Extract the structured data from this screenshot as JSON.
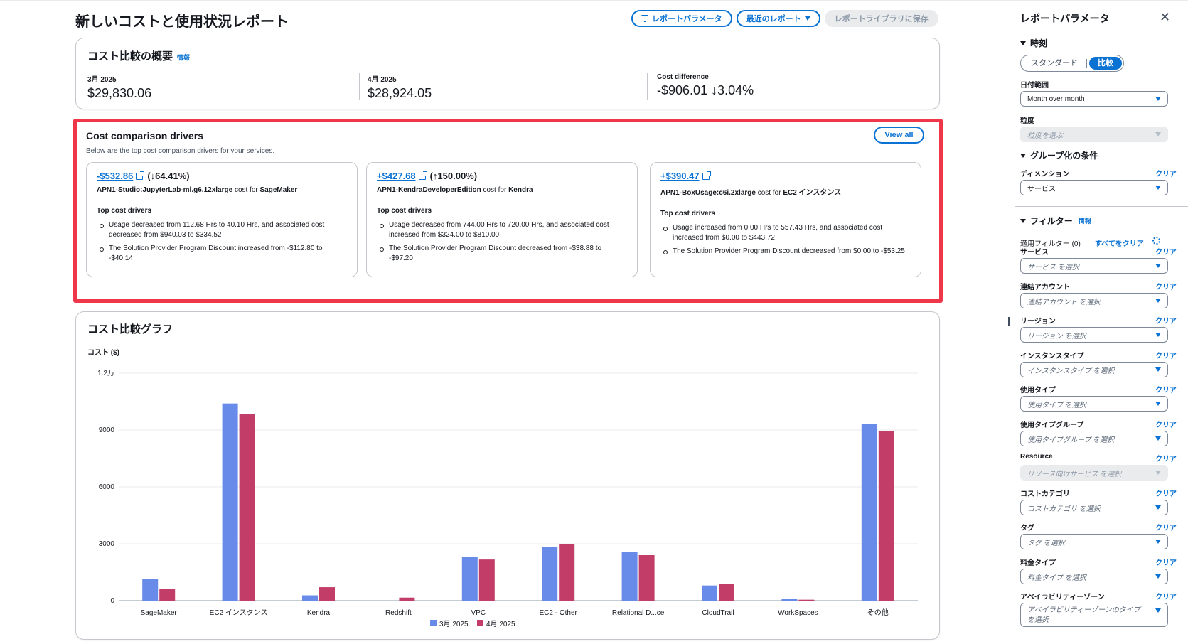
{
  "header": {
    "title": "新しいコストと使用状況レポート",
    "btn_params": "レポートパラメータ",
    "btn_recent": "最近のレポート",
    "btn_save": "レポートライブラリに保存"
  },
  "summary": {
    "title": "コスト比較の概要",
    "info": "情報",
    "items": [
      {
        "label": "3月 2025",
        "value": "$29,830.06"
      },
      {
        "label": "4月 2025",
        "value": "$28,924.05"
      },
      {
        "label": "Cost difference",
        "value": "-$906.01 ↓3.04%"
      }
    ]
  },
  "drivers": {
    "title": "Cost comparison drivers",
    "subtitle": "Below are the top cost comparison drivers for your services.",
    "view_all": "View all",
    "top_label": "Top cost drivers",
    "cost_for": "cost for",
    "cards": [
      {
        "amount": "-$532.86",
        "pct": "(↓64.41%)",
        "usage": "APN1-Studio:JupyterLab-ml.g6.12xlarge",
        "service": "SageMaker",
        "bullets": [
          "Usage decreased from 112.68 Hrs to 40.10 Hrs, and associated cost decreased from $940.03 to $334.52",
          "The Solution Provider Program Discount increased from -$112.80 to -$40.14"
        ]
      },
      {
        "amount": "+$427.68",
        "pct": "(↑150.00%)",
        "usage": "APN1-KendraDeveloperEdition",
        "service": "Kendra",
        "bullets": [
          "Usage decreased from 744.00 Hrs to 720.00 Hrs, and associated cost increased from $324.00 to $810.00",
          "The Solution Provider Program Discount decreased from -$38.88 to -$97.20"
        ]
      },
      {
        "amount": "+$390.47",
        "pct": "",
        "usage": "APN1-BoxUsage:c6i.2xlarge",
        "service": "EC2 インスタンス",
        "bullets": [
          "Usage increased from 0.00 Hrs to 557.43 Hrs, and associated cost increased from $0.00 to $443.72",
          "The Solution Provider Program Discount decreased from $0.00 to -$53.25"
        ]
      }
    ]
  },
  "chart": {
    "title": "コスト比較グラフ",
    "ylabel": "コスト ($)"
  },
  "chart_data": {
    "type": "bar",
    "categories": [
      "SageMaker",
      "EC2 インスタンス",
      "Kendra",
      "Redshift",
      "VPC",
      "EC2 - Other",
      "Relational D...ce",
      "CloudTrail",
      "WorkSpaces",
      "その他"
    ],
    "series": [
      {
        "name": "3月 2025",
        "color": "#688ae8",
        "values": [
          1150,
          10400,
          280,
          0,
          2300,
          2850,
          2550,
          800,
          90,
          9300
        ]
      },
      {
        "name": "4月 2025",
        "color": "#c33d69",
        "values": [
          600,
          9850,
          710,
          160,
          2170,
          3000,
          2400,
          900,
          50,
          8950
        ]
      }
    ],
    "yticks": [
      {
        "value": 0,
        "label": "0"
      },
      {
        "value": 3000,
        "label": "3000"
      },
      {
        "value": 6000,
        "label": "6000"
      },
      {
        "value": 9000,
        "label": "9000"
      },
      {
        "value": 12000,
        "label": "1.2万"
      }
    ],
    "ylim": [
      0,
      12000
    ],
    "grid": true,
    "legend": "bottom-center"
  },
  "panel": {
    "title": "レポートパラメータ",
    "time_section": "時刻",
    "seg_standard": "スタンダード",
    "seg_compare": "比較",
    "date_range_label": "日付範囲",
    "date_range_value": "Month over month",
    "granularity_label": "粒度",
    "granularity_placeholder": "粒度を選ぶ",
    "group_section": "グループ化の条件",
    "dimension_label": "ディメンション",
    "dimension_value": "サービス",
    "clear": "クリア",
    "filter_section": "フィルター",
    "filter_info": "情報",
    "applied_filters": "適用フィルター (0)",
    "clear_all": "すべてをクリア",
    "filters": [
      {
        "label": "サービス",
        "placeholder": "サービス を選択"
      },
      {
        "label": "連結アカウント",
        "placeholder": "連結アカウント を選択"
      },
      {
        "label": "リージョン",
        "placeholder": "リージョン を選択"
      },
      {
        "label": "インスタンスタイプ",
        "placeholder": "インスタンスタイプ を選択"
      },
      {
        "label": "使用タイプ",
        "placeholder": "使用タイプ を選択"
      },
      {
        "label": "使用タイプグループ",
        "placeholder": "使用タイプグループ を選択"
      },
      {
        "label": "Resource",
        "placeholder": "リソース向けサービス を選択"
      },
      {
        "label": "コストカテゴリ",
        "placeholder": "コストカテゴリ を選択"
      },
      {
        "label": "タグ",
        "placeholder": "タグ を選択"
      },
      {
        "label": "料金タイプ",
        "placeholder": "料金タイプ を選択"
      },
      {
        "label": "アベイラビリティーゾーン",
        "placeholder": "アベイラビリティーゾーンのタイプ を選択"
      }
    ]
  }
}
